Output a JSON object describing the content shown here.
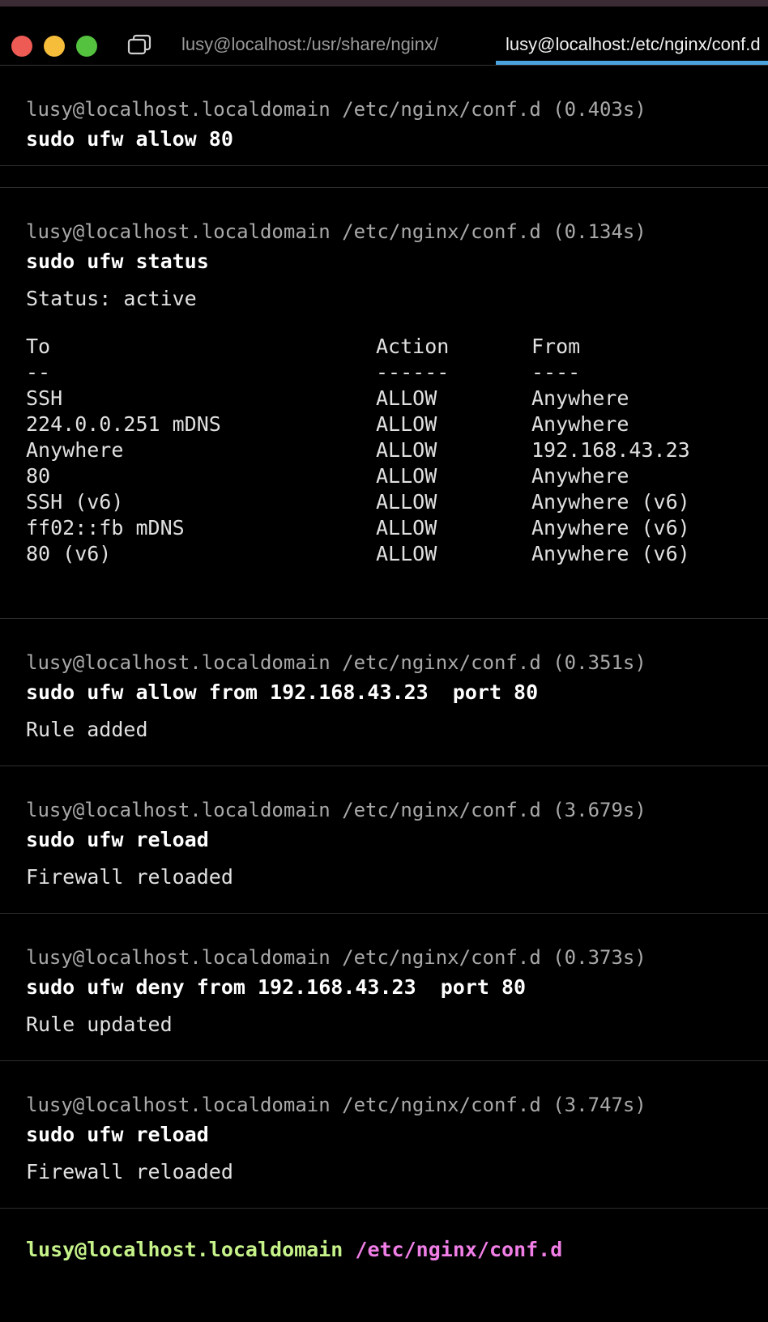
{
  "window": {
    "tabs": [
      {
        "label": "lusy@localhost:/usr/share/nginx/",
        "active": false
      },
      {
        "label": "lusy@localhost:/etc/nginx/conf.d",
        "active": true
      }
    ]
  },
  "blocks": [
    {
      "prompt": "lusy@localhost.localdomain /etc/nginx/conf.d (0.403s)",
      "command": "sudo ufw allow 80",
      "output": ""
    },
    {
      "prompt": "lusy@localhost.localdomain /etc/nginx/conf.d (0.134s)",
      "command": "sudo ufw status",
      "output": "Status: active"
    },
    {
      "prompt": "lusy@localhost.localdomain /etc/nginx/conf.d (0.351s)",
      "command": "sudo ufw allow from 192.168.43.23  port 80",
      "output": "Rule added"
    },
    {
      "prompt": "lusy@localhost.localdomain /etc/nginx/conf.d (3.679s)",
      "command": "sudo ufw reload",
      "output": "Firewall reloaded"
    },
    {
      "prompt": "lusy@localhost.localdomain /etc/nginx/conf.d (0.373s)",
      "command": "sudo ufw deny from 192.168.43.23  port 80",
      "output": "Rule updated"
    },
    {
      "prompt": "lusy@localhost.localdomain /etc/nginx/conf.d (3.747s)",
      "command": "sudo ufw reload",
      "output": "Firewall reloaded"
    }
  ],
  "status_table": {
    "headers": [
      "To",
      "Action",
      "From"
    ],
    "separators": [
      "--",
      "------",
      "----"
    ],
    "rows": [
      [
        "SSH",
        "ALLOW",
        "Anywhere"
      ],
      [
        "224.0.0.251 mDNS",
        "ALLOW",
        "Anywhere"
      ],
      [
        "Anywhere",
        "ALLOW",
        "192.168.43.23"
      ],
      [
        "80",
        "ALLOW",
        "Anywhere"
      ],
      [
        "SSH (v6)",
        "ALLOW",
        "Anywhere (v6)"
      ],
      [
        "ff02::fb mDNS",
        "ALLOW",
        "Anywhere (v6)"
      ],
      [
        "80 (v6)",
        "ALLOW",
        "Anywhere (v6)"
      ]
    ]
  },
  "current_prompt": {
    "user": "lusy@localhost.localdomain",
    "path": "/etc/nginx/conf.d"
  },
  "colors": {
    "tab_accent": "#4aa3df",
    "prompt_user": "#c6f28a",
    "prompt_path": "#f07ee6",
    "close": "#ee5b55",
    "minimize": "#f5bd3a",
    "zoom": "#54c13f"
  }
}
